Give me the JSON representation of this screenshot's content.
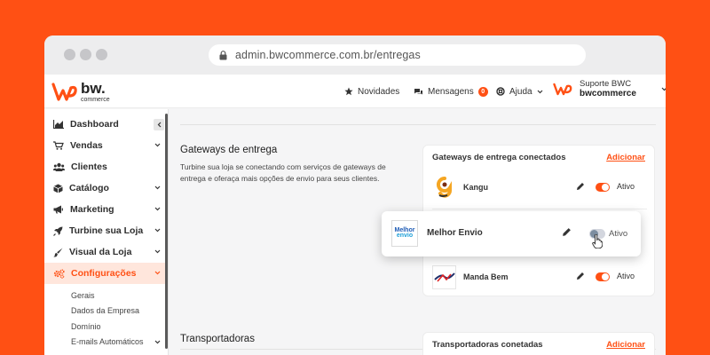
{
  "browser": {
    "url": "admin.bwcommerce.com.br/entregas"
  },
  "brand": {
    "name": "bw.",
    "tagline": "commerce",
    "accent": "#ff5014"
  },
  "topbar": {
    "news": "Novidades",
    "messages": "Mensagens",
    "messages_count": "0",
    "help": "Ajuda",
    "support_label": "Suporte BWC",
    "support_user": "bwcommerce"
  },
  "sidebar": {
    "items": [
      {
        "label": "Dashboard",
        "icon": "chart-area-icon"
      },
      {
        "label": "Vendas",
        "icon": "cart-icon"
      },
      {
        "label": "Clientes",
        "icon": "users-icon"
      },
      {
        "label": "Catálogo",
        "icon": "box-icon"
      },
      {
        "label": "Marketing",
        "icon": "megaphone-icon"
      },
      {
        "label": "Turbine sua Loja",
        "icon": "rocket-icon"
      },
      {
        "label": "Visual da Loja",
        "icon": "brush-icon"
      },
      {
        "label": "Configurações",
        "icon": "gears-icon"
      }
    ],
    "subitems": [
      "Gerais",
      "Dados da Empresa",
      "Domínio",
      "E-mails Automáticos"
    ]
  },
  "gateways": {
    "title": "Gateways de entrega",
    "description": "Turbine sua loja se conectando com serviços de gateways de entrega e oferaça mais opções de envio para seus clientes.",
    "card_title": "Gateways de entrega conectados",
    "add_label": "Adicionar",
    "items": [
      {
        "name": "Kangu",
        "status": "Ativo"
      },
      {
        "name": "Melhor Envio",
        "status": "Ativo"
      },
      {
        "name": "Manda Bem",
        "status": "Ativo"
      }
    ]
  },
  "melhor_envio_logo": {
    "line1": "Melhor",
    "line2": "envio"
  },
  "carriers": {
    "title": "Transportadoras",
    "card_title": "Transportadoras conetadas",
    "add_label": "Adicionar"
  }
}
